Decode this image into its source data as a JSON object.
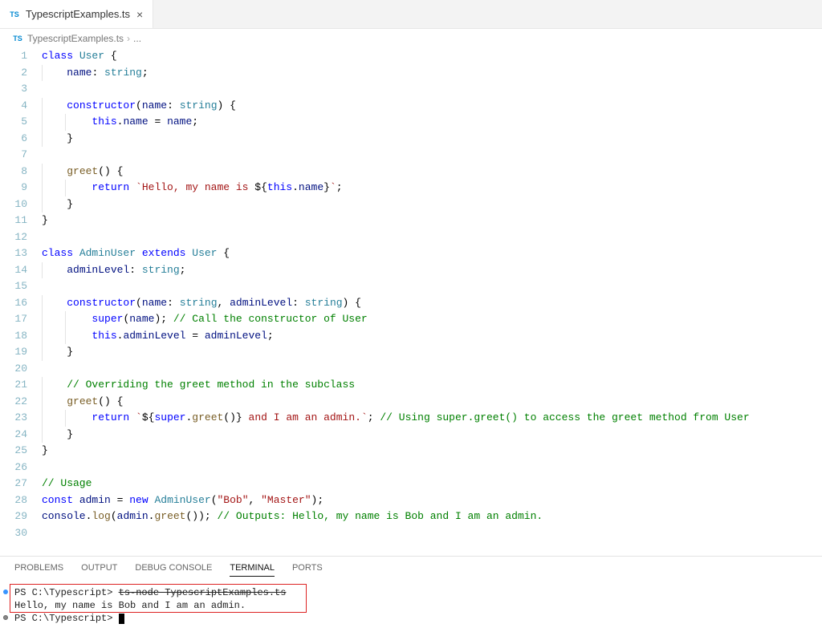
{
  "tab": {
    "filename": "TypescriptExamples.ts"
  },
  "breadcrumb": {
    "filename": "TypescriptExamples.ts",
    "sep": "›",
    "trail": "..."
  },
  "panel": {
    "tabs": {
      "problems": "PROBLEMS",
      "output": "OUTPUT",
      "debug": "DEBUG CONSOLE",
      "terminal": "TERMINAL",
      "ports": "PORTS"
    }
  },
  "terminal": {
    "line1_prefix": "PS C:\\Typescript> ",
    "line1_cmd": "ts-node TypescriptExamples.ts",
    "line2": "Hello, my name is Bob and I am an admin.",
    "line3": "PS C:\\Typescript> "
  },
  "code": {
    "l1": [
      [
        "kw",
        "class"
      ],
      [
        "pun",
        " "
      ],
      [
        "type",
        "User"
      ],
      [
        "pun",
        " {"
      ]
    ],
    "l2": [
      [
        "pun",
        "    "
      ],
      [
        "var",
        "name"
      ],
      [
        "pun",
        ": "
      ],
      [
        "type",
        "string"
      ],
      [
        "pun",
        ";"
      ]
    ],
    "l3": [
      [
        "pun",
        ""
      ]
    ],
    "l4": [
      [
        "pun",
        "    "
      ],
      [
        "kw",
        "constructor"
      ],
      [
        "pun",
        "("
      ],
      [
        "var",
        "name"
      ],
      [
        "pun",
        ": "
      ],
      [
        "type",
        "string"
      ],
      [
        "pun",
        ") {"
      ]
    ],
    "l5": [
      [
        "pun",
        "        "
      ],
      [
        "kw",
        "this"
      ],
      [
        "pun",
        "."
      ],
      [
        "var",
        "name"
      ],
      [
        "pun",
        " = "
      ],
      [
        "var",
        "name"
      ],
      [
        "pun",
        ";"
      ]
    ],
    "l6": [
      [
        "pun",
        "    }"
      ]
    ],
    "l7": [
      [
        "pun",
        ""
      ]
    ],
    "l8": [
      [
        "pun",
        "    "
      ],
      [
        "fn",
        "greet"
      ],
      [
        "pun",
        "() {"
      ]
    ],
    "l9": [
      [
        "pun",
        "        "
      ],
      [
        "kw",
        "return"
      ],
      [
        "pun",
        " "
      ],
      [
        "str",
        "`Hello, my name is "
      ],
      [
        "pun",
        "${"
      ],
      [
        "kw",
        "this"
      ],
      [
        "pun",
        "."
      ],
      [
        "var",
        "name"
      ],
      [
        "pun",
        "}"
      ],
      [
        "str",
        "`"
      ],
      [
        "pun",
        ";"
      ]
    ],
    "l10": [
      [
        "pun",
        "    }"
      ]
    ],
    "l11": [
      [
        "pun",
        "}"
      ]
    ],
    "l12": [
      [
        "pun",
        ""
      ]
    ],
    "l13": [
      [
        "kw",
        "class"
      ],
      [
        "pun",
        " "
      ],
      [
        "type",
        "AdminUser"
      ],
      [
        "pun",
        " "
      ],
      [
        "kw",
        "extends"
      ],
      [
        "pun",
        " "
      ],
      [
        "type",
        "User"
      ],
      [
        "pun",
        " {"
      ]
    ],
    "l14": [
      [
        "pun",
        "    "
      ],
      [
        "var",
        "adminLevel"
      ],
      [
        "pun",
        ": "
      ],
      [
        "type",
        "string"
      ],
      [
        "pun",
        ";"
      ]
    ],
    "l15": [
      [
        "pun",
        ""
      ]
    ],
    "l16": [
      [
        "pun",
        "    "
      ],
      [
        "kw",
        "constructor"
      ],
      [
        "pun",
        "("
      ],
      [
        "var",
        "name"
      ],
      [
        "pun",
        ": "
      ],
      [
        "type",
        "string"
      ],
      [
        "pun",
        ", "
      ],
      [
        "var",
        "adminLevel"
      ],
      [
        "pun",
        ": "
      ],
      [
        "type",
        "string"
      ],
      [
        "pun",
        ") {"
      ]
    ],
    "l17": [
      [
        "pun",
        "        "
      ],
      [
        "kw",
        "super"
      ],
      [
        "pun",
        "("
      ],
      [
        "var",
        "name"
      ],
      [
        "pun",
        "); "
      ],
      [
        "cmt",
        "// Call the constructor of User"
      ]
    ],
    "l18": [
      [
        "pun",
        "        "
      ],
      [
        "kw",
        "this"
      ],
      [
        "pun",
        "."
      ],
      [
        "var",
        "adminLevel"
      ],
      [
        "pun",
        " = "
      ],
      [
        "var",
        "adminLevel"
      ],
      [
        "pun",
        ";"
      ]
    ],
    "l19": [
      [
        "pun",
        "    }"
      ]
    ],
    "l20": [
      [
        "pun",
        ""
      ]
    ],
    "l21": [
      [
        "pun",
        "    "
      ],
      [
        "cmt",
        "// Overriding the greet method in the subclass"
      ]
    ],
    "l22": [
      [
        "pun",
        "    "
      ],
      [
        "fn",
        "greet"
      ],
      [
        "pun",
        "() {"
      ]
    ],
    "l23": [
      [
        "pun",
        "        "
      ],
      [
        "kw",
        "return"
      ],
      [
        "pun",
        " "
      ],
      [
        "str",
        "`"
      ],
      [
        "pun",
        "${"
      ],
      [
        "kw",
        "super"
      ],
      [
        "pun",
        "."
      ],
      [
        "fn",
        "greet"
      ],
      [
        "pun",
        "()}"
      ],
      [
        "str",
        " and I am an admin.`"
      ],
      [
        "pun",
        "; "
      ],
      [
        "cmt",
        "// Using super.greet() to access the greet method from User"
      ]
    ],
    "l24": [
      [
        "pun",
        "    }"
      ]
    ],
    "l25": [
      [
        "pun",
        "}"
      ]
    ],
    "l26": [
      [
        "pun",
        ""
      ]
    ],
    "l27": [
      [
        "cmt",
        "// Usage"
      ]
    ],
    "l28": [
      [
        "kw",
        "const"
      ],
      [
        "pun",
        " "
      ],
      [
        "var",
        "admin"
      ],
      [
        "pun",
        " = "
      ],
      [
        "kw",
        "new"
      ],
      [
        "pun",
        " "
      ],
      [
        "type",
        "AdminUser"
      ],
      [
        "pun",
        "("
      ],
      [
        "str",
        "\"Bob\""
      ],
      [
        "pun",
        ", "
      ],
      [
        "str",
        "\"Master\""
      ],
      [
        "pun",
        ");"
      ]
    ],
    "l29": [
      [
        "var",
        "console"
      ],
      [
        "pun",
        "."
      ],
      [
        "fn",
        "log"
      ],
      [
        "pun",
        "("
      ],
      [
        "var",
        "admin"
      ],
      [
        "pun",
        "."
      ],
      [
        "fn",
        "greet"
      ],
      [
        "pun",
        "()); "
      ],
      [
        "cmt",
        "// Outputs: Hello, my name is Bob and I am an admin."
      ]
    ],
    "l30": [
      [
        "pun",
        ""
      ]
    ]
  }
}
